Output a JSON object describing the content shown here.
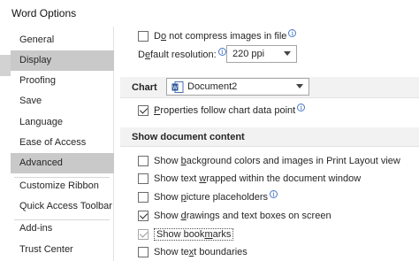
{
  "window": {
    "title": "Word Options"
  },
  "sidebar": {
    "items": [
      {
        "label": "General"
      },
      {
        "label": "Display"
      },
      {
        "label": "Proofing"
      },
      {
        "label": "Save"
      },
      {
        "label": "Language"
      },
      {
        "label": "Ease of Access"
      },
      {
        "label": "Advanced"
      },
      {
        "label": "Customize Ribbon"
      },
      {
        "label": "Quick Access Toolbar"
      },
      {
        "label": "Add-ins"
      },
      {
        "label": "Trust Center"
      }
    ]
  },
  "image_options": {
    "no_compress": {
      "pre": "D",
      "ul": "o",
      "post": " not compress images in file",
      "checked": false
    },
    "resolution": {
      "pre": "D",
      "ul": "e",
      "post": "fault resolution:",
      "value": "220 ppi"
    }
  },
  "chart": {
    "label": "Chart",
    "document_value": "Document2",
    "properties_follow": {
      "pre": "",
      "ul": "P",
      "post": "roperties follow chart data point",
      "checked": true
    }
  },
  "show_document_content": {
    "header": "Show document content",
    "options": [
      {
        "pre": "Show ",
        "ul": "b",
        "post": "ackground colors and images in Print Layout view",
        "checked": false
      },
      {
        "pre": "Show text ",
        "ul": "w",
        "post": "rapped within the document window",
        "checked": false
      },
      {
        "pre": "Show ",
        "ul": "p",
        "post": "icture placeholders",
        "checked": false
      },
      {
        "pre": "Show ",
        "ul": "d",
        "post": "rawings and text boxes on screen",
        "checked": true
      },
      {
        "pre": "Show book",
        "ul": "m",
        "post": "arks",
        "checked": true
      },
      {
        "pre": "Show te",
        "ul": "x",
        "post": "t boundaries",
        "checked": false
      }
    ]
  },
  "colors": {
    "selected_nav_bg": "#c9c9c9",
    "section_bg": "#f2f2f2"
  }
}
